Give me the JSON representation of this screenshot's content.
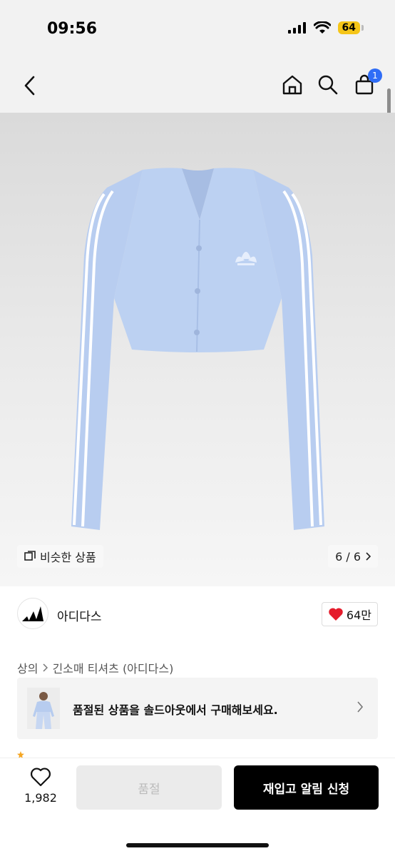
{
  "status": {
    "time": "09:56",
    "battery": "64"
  },
  "header": {
    "cart_count": "1"
  },
  "gallery": {
    "similar_label": "비슷한 상품",
    "page": "6 / 6"
  },
  "brand": {
    "name": "아디다스",
    "likes": "64만"
  },
  "breadcrumb": {
    "category": "상의",
    "subcategory": "긴소매 티셔츠 (아디다스)"
  },
  "banner": {
    "text": "품절된 상품을 솔드아웃에서 구매해보세요."
  },
  "bottom": {
    "wish_count": "1,982",
    "soldout_label": "품절",
    "restock_label": "재입고 알림 신청"
  },
  "colors": {
    "accent": "#2f6df6",
    "heart": "#e51c2c",
    "garment": "#b9cff0",
    "battery": "#f5c518"
  },
  "icons": [
    "back-icon",
    "home-icon",
    "search-icon",
    "cart-icon",
    "similar-icon",
    "chevron-right-icon",
    "adidas-logo",
    "heart-icon",
    "heart-outline-icon"
  ]
}
